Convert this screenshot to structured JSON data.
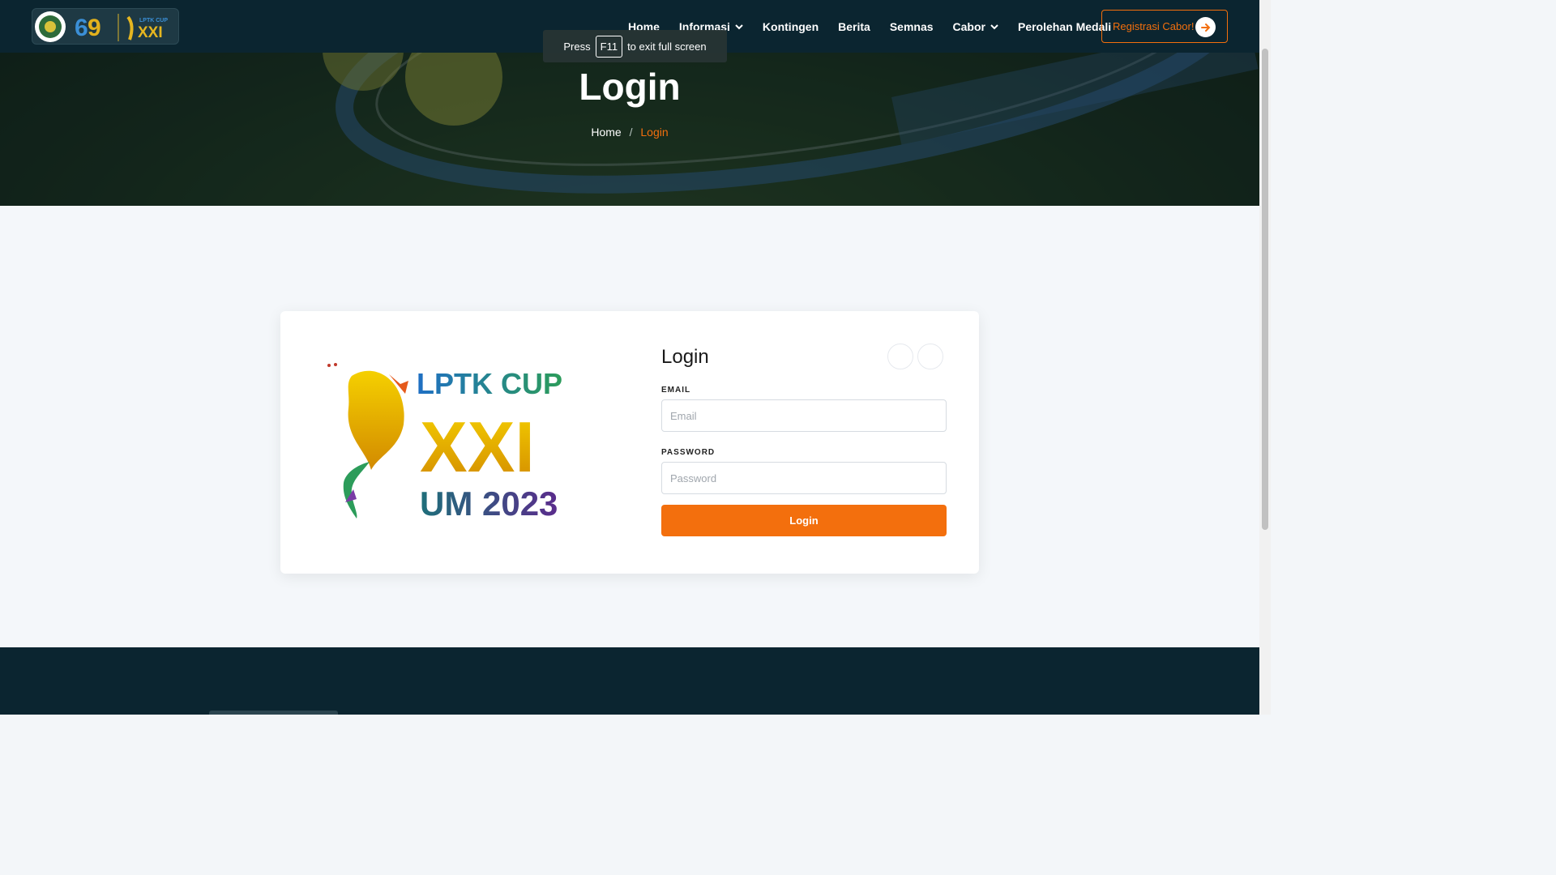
{
  "nav": {
    "items": [
      {
        "label": "Home",
        "dropdown": false
      },
      {
        "label": "Informasi",
        "dropdown": true
      },
      {
        "label": "Kontingen",
        "dropdown": false
      },
      {
        "label": "Berita",
        "dropdown": false
      },
      {
        "label": "Semnas",
        "dropdown": false
      },
      {
        "label": "Cabor",
        "dropdown": true
      },
      {
        "label": "Perolehan Medali",
        "dropdown": false
      }
    ],
    "register_label": "Registrasi Cabor!",
    "logo_text": "LPTK CUP XXI"
  },
  "toast": {
    "press": "Press",
    "key": "F11",
    "suffix": "to exit full screen"
  },
  "hero": {
    "title": "Login",
    "breadcrumb_home": "Home",
    "breadcrumb_sep": "/",
    "breadcrumb_current": "Login"
  },
  "event_logo": {
    "line1": "LPTK CUP",
    "line2": "XXI",
    "line3": "UM 2023"
  },
  "login": {
    "title": "Login",
    "email_label": "EMAIL",
    "email_placeholder": "Email",
    "password_label": "PASSWORD",
    "password_placeholder": "Password",
    "submit_label": "Login"
  },
  "colors": {
    "accent": "#f36f0d",
    "navy": "#0b2530"
  }
}
